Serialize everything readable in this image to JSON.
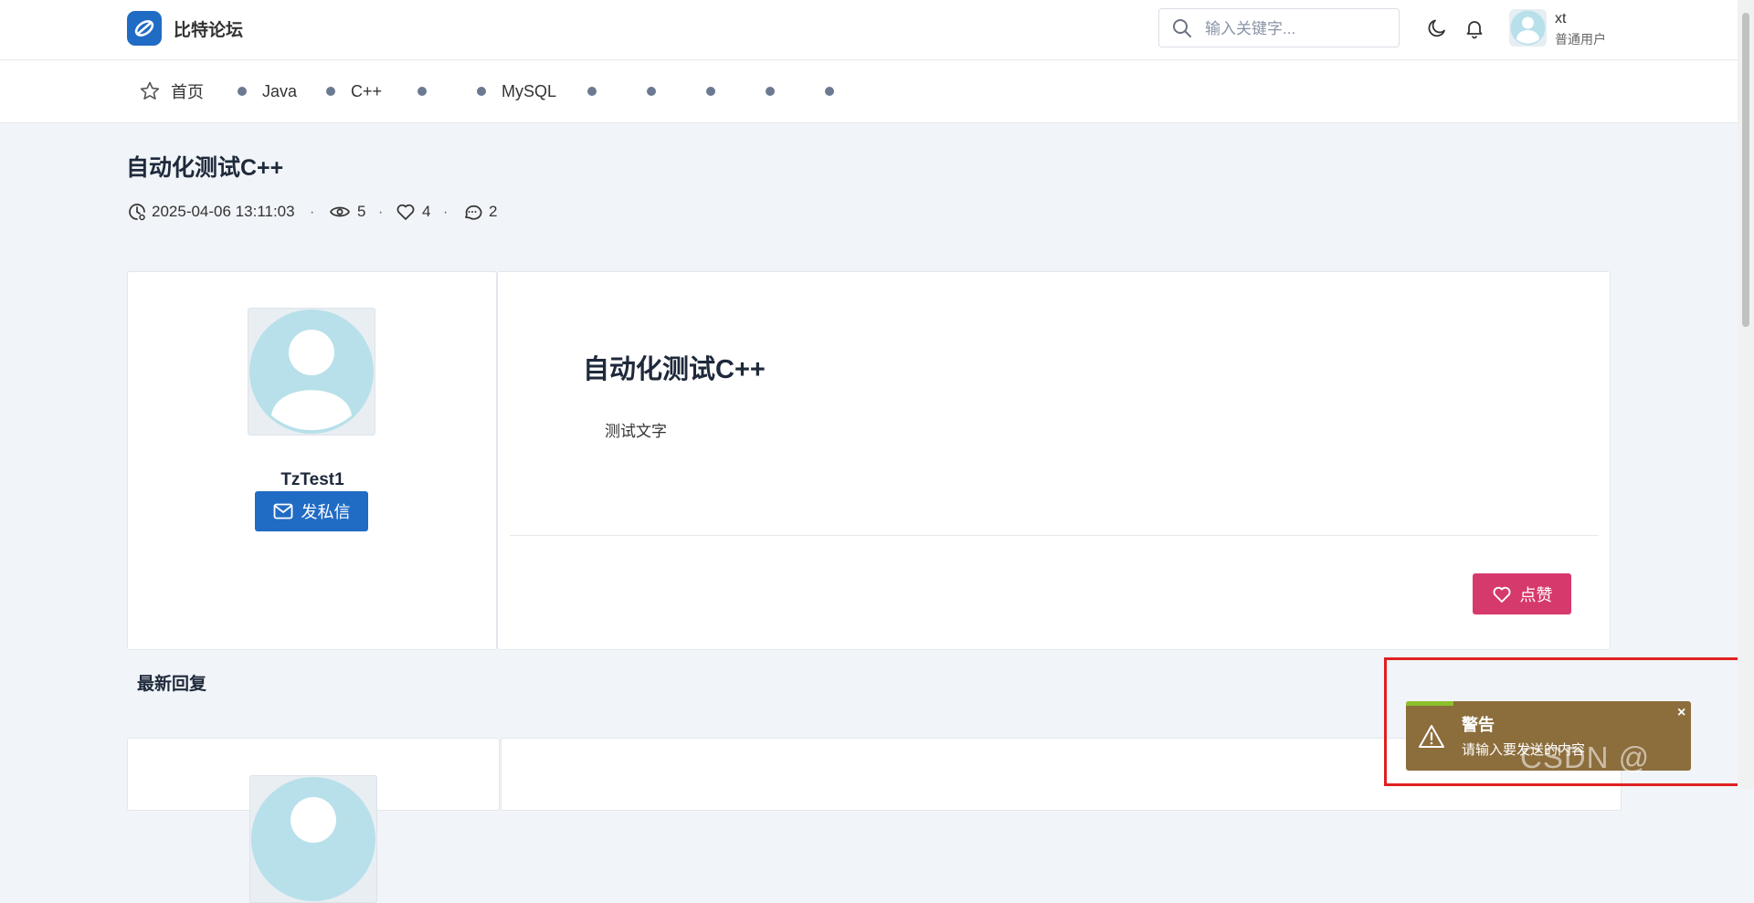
{
  "header": {
    "brand": "比特论坛",
    "search_placeholder": "输入关键字...",
    "user": {
      "name": "xt",
      "role": "普通用户"
    }
  },
  "nav": {
    "home": "首页",
    "items": [
      "Java",
      "C++",
      "",
      "MySQL",
      "",
      "",
      "",
      "",
      ""
    ]
  },
  "post": {
    "title": "自动化测试C++",
    "datetime": "2025-04-06 13:11:03",
    "views": "5",
    "likes": "4",
    "comments": "2",
    "separator": "·",
    "content_title": "自动化测试C++",
    "content_text": "测试文字",
    "like_label": "点赞"
  },
  "author": {
    "name": "TzTest1",
    "message_label": "发私信"
  },
  "replies": {
    "title": "最新回复"
  },
  "toast": {
    "title": "警告",
    "message": "请输入要发送的内容",
    "close": "×",
    "watermark": "CSDN @"
  },
  "colors": {
    "primary": "#206bc4",
    "like": "#d63a6c",
    "toast_bg": "#8c6d3c",
    "toast_accent": "#8dc12a",
    "highlight": "#e02020"
  }
}
